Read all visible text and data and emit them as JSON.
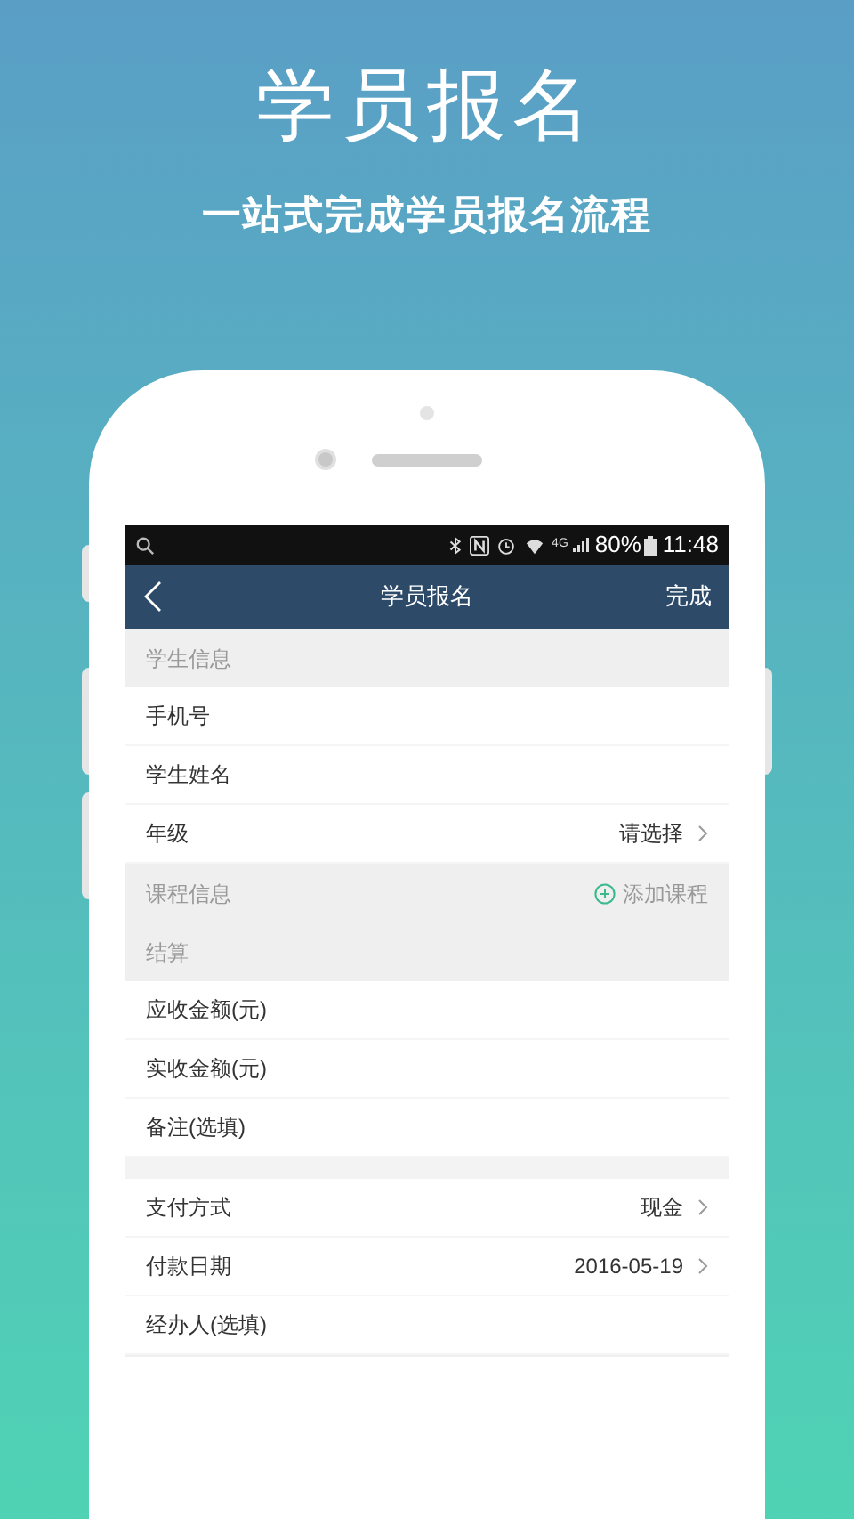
{
  "headline": "学员报名",
  "tagline": "一站式完成学员报名流程",
  "status_bar": {
    "network": "4G",
    "battery": "80%",
    "time": "11:48"
  },
  "nav_bar": {
    "title": "学员报名",
    "action": "完成"
  },
  "rows": [
    {
      "kind": "section",
      "label": "学生信息"
    },
    {
      "kind": "field",
      "label": "手机号"
    },
    {
      "kind": "field",
      "label": "学生姓名"
    },
    {
      "kind": "select",
      "label": "年级",
      "value": "请选择"
    },
    {
      "kind": "section",
      "label": "课程信息",
      "action": "添加课程"
    },
    {
      "kind": "section",
      "label": "结算"
    },
    {
      "kind": "field",
      "label": "应收金额(元)"
    },
    {
      "kind": "field",
      "label": "实收金额(元)"
    },
    {
      "kind": "field",
      "label": "备注(选填)"
    },
    {
      "kind": "spacer"
    },
    {
      "kind": "select",
      "label": "支付方式",
      "value": "现金"
    },
    {
      "kind": "select",
      "label": "付款日期",
      "value": "2016-05-19"
    },
    {
      "kind": "field",
      "label": "经办人(选填)"
    }
  ]
}
